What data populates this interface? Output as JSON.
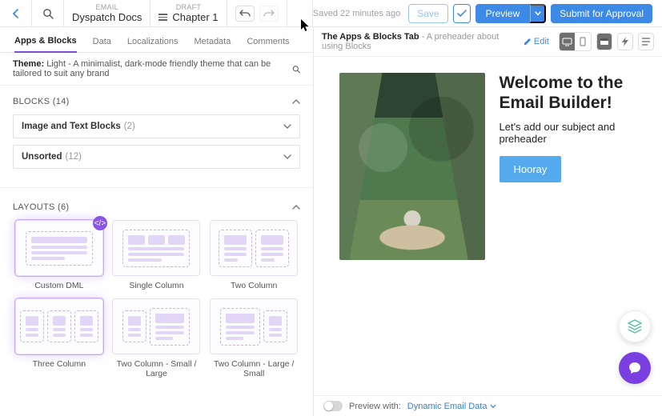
{
  "header": {
    "email_label": "EMAIL",
    "email_title": "Dyspatch Docs",
    "draft_label": "DRAFT",
    "draft_title": "Chapter 1",
    "saved": "Saved 22 minutes ago",
    "save": "Save",
    "preview": "Preview",
    "submit": "Submit for Approval"
  },
  "tabs": [
    "Apps & Blocks",
    "Data",
    "Localizations",
    "Metadata",
    "Comments"
  ],
  "theme": {
    "label": "Theme:",
    "name": "Light",
    "desc": "- A minimalist, dark-mode friendly theme that can be tailored to suit any brand"
  },
  "blocks": {
    "title": "BLOCKS (14)",
    "groups": [
      {
        "label": "Image and Text Blocks",
        "count": "(2)"
      },
      {
        "label": "Unsorted",
        "count": "(12)"
      }
    ]
  },
  "layouts": {
    "title": "LAYOUTS (6)",
    "items": [
      "Custom DML",
      "Single Column",
      "Two Column",
      "Three Column",
      "Two Column - Small / Large",
      "Two Column - Large / Small"
    ]
  },
  "preview_header": {
    "title": "The Apps & Blocks Tab",
    "sub": " - A preheader about using Blocks",
    "edit": "Edit"
  },
  "email": {
    "heading": "Welcome to the Email Builder!",
    "body": "Let's add our subject and preheader",
    "cta": "Hooray"
  },
  "previewbar": {
    "label": "Preview with:",
    "value": "Dynamic Email Data"
  }
}
